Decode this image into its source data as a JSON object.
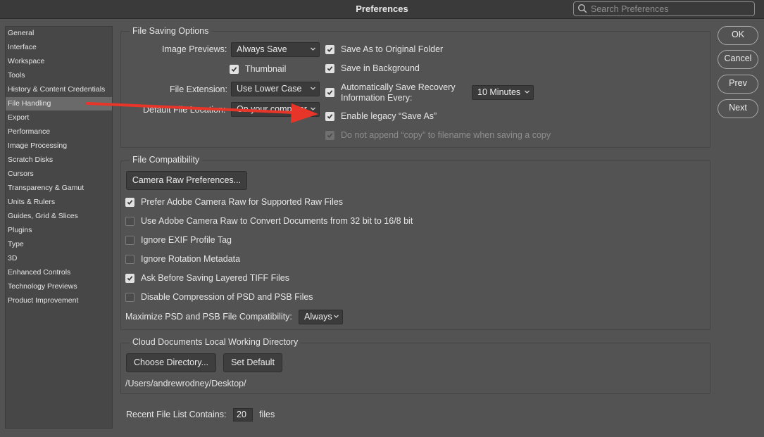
{
  "window": {
    "title": "Preferences"
  },
  "search": {
    "placeholder": "Search Preferences"
  },
  "sidebar": {
    "items": [
      {
        "label": "General"
      },
      {
        "label": "Interface"
      },
      {
        "label": "Workspace"
      },
      {
        "label": "Tools"
      },
      {
        "label": "History & Content Credentials"
      },
      {
        "label": "File Handling",
        "selected": true
      },
      {
        "label": "Export"
      },
      {
        "label": "Performance"
      },
      {
        "label": "Image Processing"
      },
      {
        "label": "Scratch Disks"
      },
      {
        "label": "Cursors"
      },
      {
        "label": "Transparency & Gamut"
      },
      {
        "label": "Units & Rulers"
      },
      {
        "label": "Guides, Grid & Slices"
      },
      {
        "label": "Plugins"
      },
      {
        "label": "Type"
      },
      {
        "label": "3D"
      },
      {
        "label": "Enhanced Controls"
      },
      {
        "label": "Technology Previews"
      },
      {
        "label": "Product Improvement"
      }
    ]
  },
  "file_saving": {
    "title": "File Saving Options",
    "image_previews_label": "Image Previews:",
    "image_previews_value": "Always Save",
    "thumbnail_label": "Thumbnail",
    "thumbnail_checked": true,
    "file_extension_label": "File Extension:",
    "file_extension_value": "Use Lower Case",
    "default_location_label": "Default File Location:",
    "default_location_value": "On your computer",
    "save_as_original_label": "Save As to Original Folder",
    "save_in_background_label": "Save in Background",
    "auto_save_line1": "Automatically Save Recovery",
    "auto_save_line2": "Information Every:",
    "auto_save_interval": "10 Minutes",
    "legacy_save_as_label": "Enable legacy “Save As”",
    "no_copy_label": "Do not append “copy” to filename when saving a copy"
  },
  "file_compat": {
    "title": "File Compatibility",
    "camera_raw_prefs_button": "Camera Raw Preferences...",
    "options": [
      {
        "label": "Prefer Adobe Camera Raw for Supported Raw Files",
        "checked": true
      },
      {
        "label": "Use Adobe Camera Raw to Convert Documents from 32 bit to 16/8 bit",
        "checked": false
      },
      {
        "label": "Ignore EXIF Profile Tag",
        "checked": false
      },
      {
        "label": "Ignore Rotation Metadata",
        "checked": false
      },
      {
        "label": "Ask Before Saving Layered TIFF Files",
        "checked": true
      },
      {
        "label": "Disable Compression of PSD and PSB Files",
        "checked": false
      }
    ],
    "maximize_label": "Maximize PSD and PSB File Compatibility:",
    "maximize_value": "Always"
  },
  "cloud_docs": {
    "title": "Cloud Documents Local Working Directory",
    "choose_button": "Choose Directory...",
    "set_default_button": "Set Default",
    "path": "/Users/andrewrodney/Desktop/"
  },
  "recent_files": {
    "label": "Recent File List Contains:",
    "value": "20",
    "suffix": "files"
  },
  "buttons": {
    "ok": "OK",
    "cancel": "Cancel",
    "prev": "Prev",
    "next": "Next"
  },
  "colors": {
    "annotation_arrow": "#e8352a",
    "background": "#535353"
  }
}
